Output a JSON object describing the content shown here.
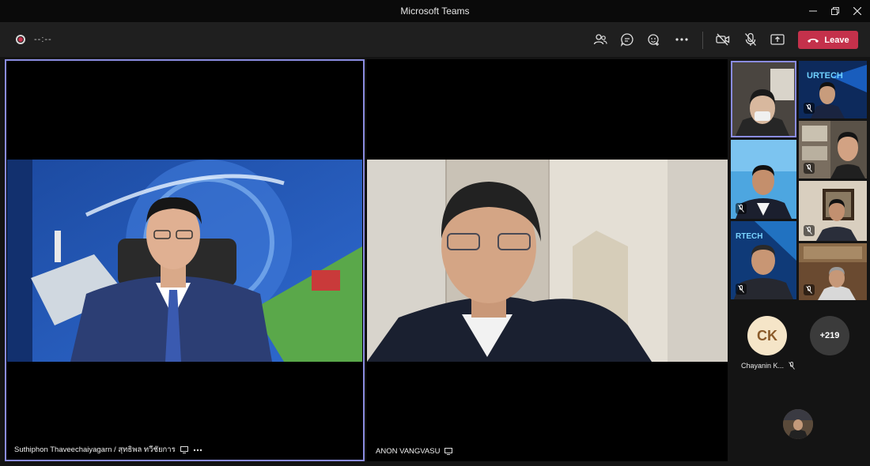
{
  "window": {
    "title": "Microsoft Teams"
  },
  "toolbar": {
    "timer": "--:--",
    "leave_label": "Leave"
  },
  "main_tiles": [
    {
      "name": "Suthiphon Thaveechaiyagarn / สุทธิพล ทวีชัยการ"
    },
    {
      "name": "ANON VANGVASU"
    }
  ],
  "gallery": {
    "avatar_initials": "CK",
    "avatar_name": "Chayanin K...",
    "overflow_count": "+219"
  },
  "colors": {
    "leave": "#c4314b",
    "active_outline": "#8a8ce0",
    "banner_blue": "#1e4da0"
  },
  "icons": [
    "participants-icon",
    "chat-icon",
    "reactions-icon",
    "more-icon",
    "camera-off-icon",
    "mic-off-icon",
    "share-icon",
    "phone-icon"
  ]
}
